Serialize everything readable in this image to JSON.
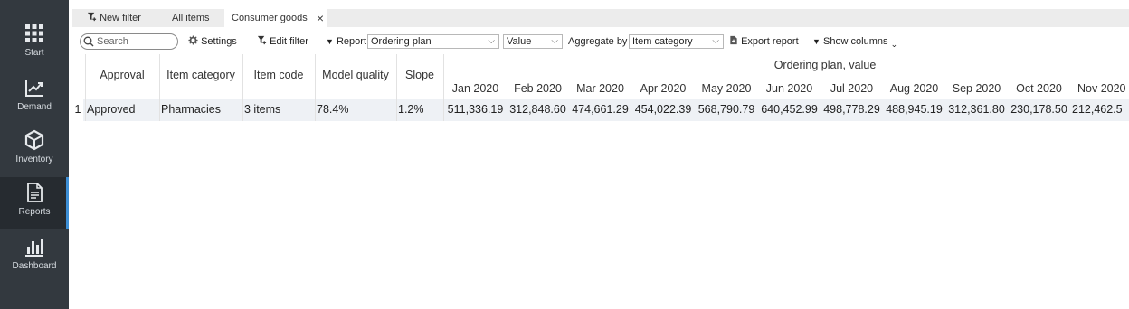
{
  "sidebar": {
    "items": [
      {
        "label": "Start",
        "icon": "grid-icon"
      },
      {
        "label": "Demand",
        "icon": "trend-chart-icon"
      },
      {
        "label": "Inventory",
        "icon": "box-icon"
      },
      {
        "label": "Reports",
        "icon": "document-icon"
      },
      {
        "label": "Dashboard",
        "icon": "bar-chart-icon"
      }
    ],
    "active": "Reports",
    "accent": "#3d8fd6"
  },
  "tabs": [
    {
      "label": "New filter",
      "icon": "filter-plus-icon"
    },
    {
      "label": "All items"
    },
    {
      "label": "Consumer goods",
      "close": "×"
    }
  ],
  "toolbar": {
    "search_placeholder": "Search",
    "settings_label": "Settings",
    "edit_filter_label": "Edit filter",
    "report_label": "Report",
    "report_value": "Ordering plan",
    "value_select": "Value",
    "aggregate_label": "Aggregate by",
    "aggregate_value": "Item category",
    "export_label": "Export report",
    "show_columns_label": "Show columns"
  },
  "table": {
    "group_header": "Ordering plan, value",
    "columns": [
      "Approval",
      "Item category",
      "Item code",
      "Model quality",
      "Slope"
    ],
    "months": [
      "Jan 2020",
      "Feb 2020",
      "Mar 2020",
      "Apr 2020",
      "May 2020",
      "Jun 2020",
      "Jul 2020",
      "Aug 2020",
      "Sep 2020",
      "Oct 2020",
      "Nov 2020"
    ],
    "rows": [
      {
        "index": "1",
        "approval": "Approved",
        "item_category": "Pharmacies",
        "item_code": "3 items",
        "model_quality": "78.4%",
        "slope": "1.2%",
        "values": [
          "511,336.19",
          "312,848.60",
          "474,661.29",
          "454,022.39",
          "568,790.79",
          "640,452.99",
          "498,778.29",
          "488,945.19",
          "312,361.80",
          "230,178.50",
          "212,462.5"
        ]
      }
    ]
  }
}
